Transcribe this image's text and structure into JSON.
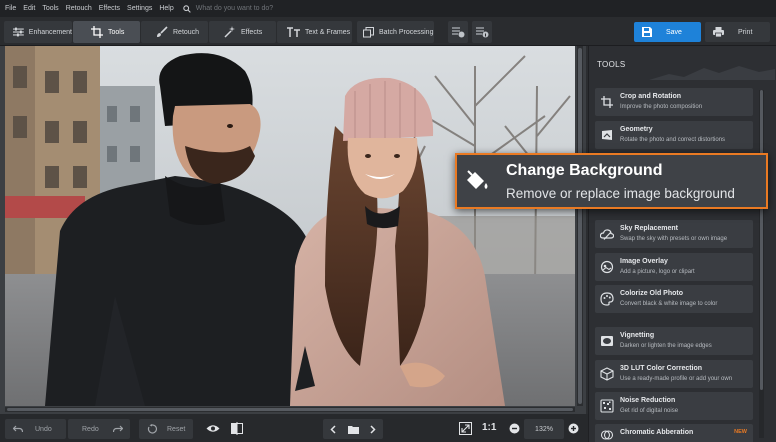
{
  "menu": {
    "items": [
      "File",
      "Edit",
      "Tools",
      "Retouch",
      "Effects",
      "Settings",
      "Help"
    ],
    "search_placeholder": "What do you want to do?"
  },
  "toolbar": {
    "tabs": [
      {
        "label": "Enhancement",
        "icon": "sliders-icon"
      },
      {
        "label": "Tools",
        "icon": "crop-icon",
        "active": true
      },
      {
        "label": "Retouch",
        "icon": "brush-icon"
      },
      {
        "label": "Effects",
        "icon": "magic-wand-icon"
      },
      {
        "label": "Text & Frames",
        "icon": "text-icon"
      },
      {
        "label": "Batch Processing",
        "icon": "batch-icon"
      }
    ],
    "save_label": "Save",
    "print_label": "Print"
  },
  "panel": {
    "title": "TOOLS",
    "tools": [
      {
        "title": "Crop and Rotation",
        "desc": "Improve the photo composition",
        "icon": "crop-rotate-icon"
      },
      {
        "title": "Geometry",
        "desc": "Rotate the photo and correct distortions",
        "icon": "geometry-icon"
      },
      {
        "title": "Sky Replacement",
        "desc": "Swap the sky with presets or own image",
        "icon": "cloud-icon"
      },
      {
        "title": "Image Overlay",
        "desc": "Add a picture, logo or clipart",
        "icon": "overlay-icon"
      },
      {
        "title": "Colorize Old Photo",
        "desc": "Convert black & white image to color",
        "icon": "palette-icon"
      },
      {
        "title": "Vignetting",
        "desc": "Darken or lighten the image edges",
        "icon": "vignette-icon"
      },
      {
        "title": "3D LUT Color Correction",
        "desc": "Use a ready-made profile or add your own",
        "icon": "cube-icon"
      },
      {
        "title": "Noise Reduction",
        "desc": "Get rid of digital noise",
        "icon": "noise-icon"
      },
      {
        "title": "Chromatic Abberation",
        "desc": "",
        "badge": "NEW",
        "icon": "aberration-icon"
      }
    ]
  },
  "callout": {
    "title": "Change Background",
    "desc": "Remove or replace image background",
    "icon": "paint-bucket-icon"
  },
  "bottom": {
    "undo": "Undo",
    "redo": "Redo",
    "reset": "Reset",
    "one_to_one": "1:1",
    "zoom": "132%"
  },
  "colors": {
    "accent": "#ea7a23",
    "save_blue": "#1e82d9",
    "bg": "#2b2d30"
  }
}
